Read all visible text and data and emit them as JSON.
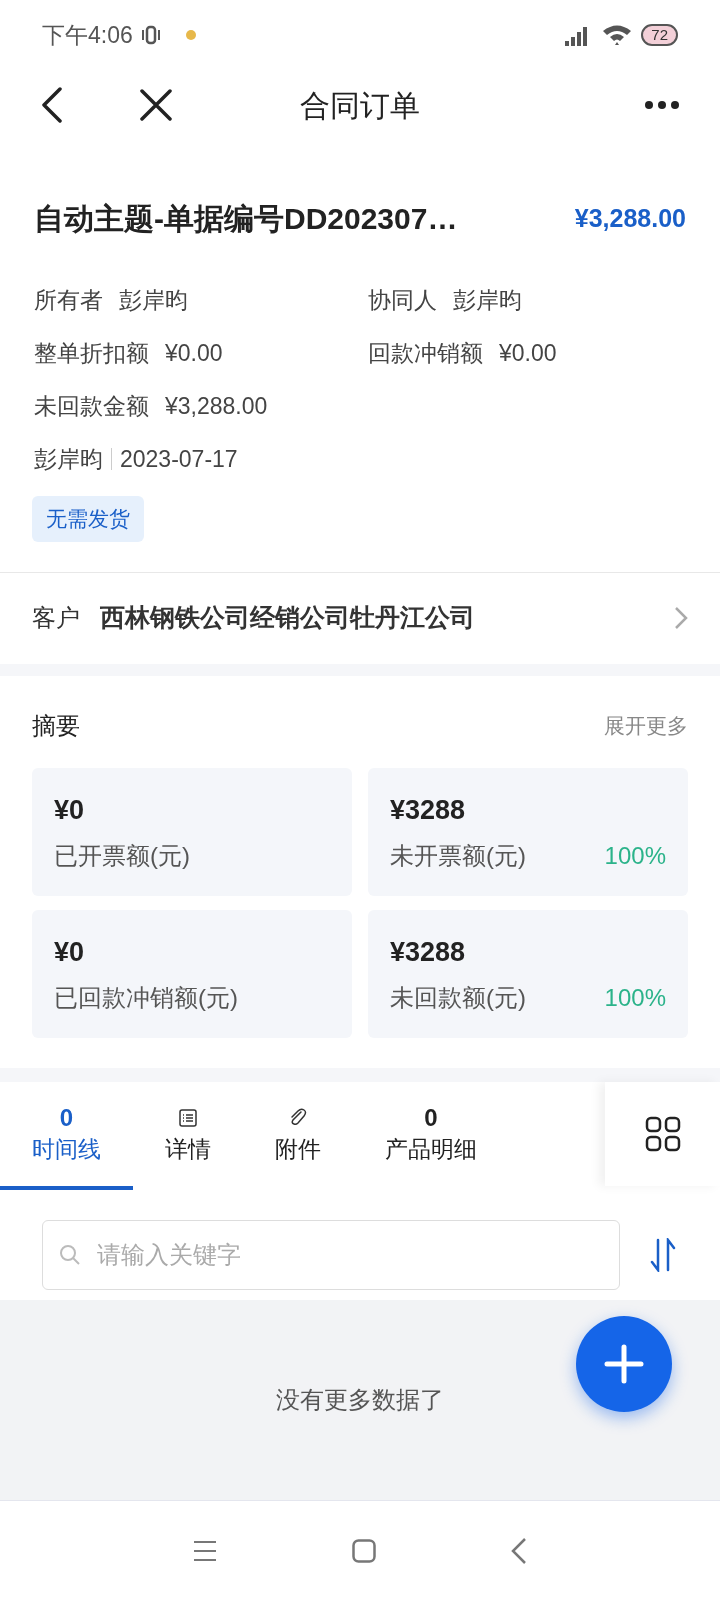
{
  "status_bar": {
    "time": "下午4:06",
    "battery": "72"
  },
  "header": {
    "title": "合同订单"
  },
  "order": {
    "title": "自动主题-单据编号DD202307…",
    "amount": "¥3,288.00",
    "fields": [
      {
        "label": "所有者",
        "value": "彭岸昀"
      },
      {
        "label": "协同人",
        "value": "彭岸昀"
      },
      {
        "label": "整单折扣额",
        "value": "¥0.00"
      },
      {
        "label": "回款冲销额",
        "value": "¥0.00"
      },
      {
        "label": "未回款金额",
        "value": "¥3,288.00"
      }
    ],
    "creator": "彭岸昀",
    "date": "2023-07-17",
    "tag": "无需发货"
  },
  "customer": {
    "label": "客户",
    "value": "西林钢铁公司经销公司牡丹江公司"
  },
  "summary": {
    "title": "摘要",
    "more": "展开更多",
    "cards": [
      {
        "amount": "¥0",
        "label": "已开票额(元)"
      },
      {
        "amount": "¥3288",
        "label": "未开票额(元)",
        "percent": "100%"
      },
      {
        "amount": "¥0",
        "label": "已回款冲销额(元)"
      },
      {
        "amount": "¥3288",
        "label": "未回款额(元)",
        "percent": "100%"
      }
    ]
  },
  "tabs": [
    {
      "kind": "count",
      "count": "0",
      "label": "时间线",
      "selected": true
    },
    {
      "kind": "list",
      "label": "详情",
      "selected": false
    },
    {
      "kind": "clip",
      "label": "附件",
      "selected": false
    },
    {
      "kind": "count",
      "count": "0",
      "label": "产品明细",
      "selected": false
    }
  ],
  "search": {
    "placeholder": "请输入关键字"
  },
  "empty_message": "没有更多数据了"
}
